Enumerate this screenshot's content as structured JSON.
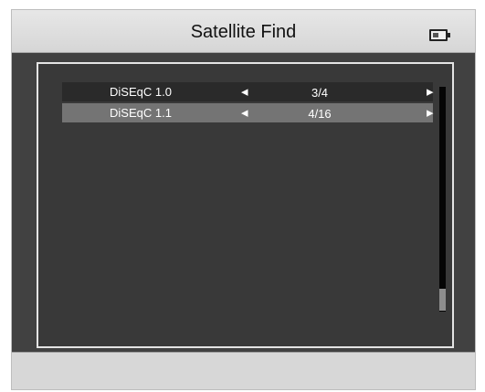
{
  "header": {
    "title": "Satellite Find",
    "battery_icon": "battery-icon"
  },
  "menu": {
    "items": [
      {
        "label": "DiSEqC 1.0",
        "value": "3/4",
        "selected": false
      },
      {
        "label": "DiSEqC 1.1",
        "value": "4/16",
        "selected": true
      }
    ],
    "left_arrow": "◂",
    "right_arrow": "▸"
  },
  "scroll": {
    "position_fraction": 0.9
  },
  "colors": {
    "screen_bg": "#d2d2d2",
    "content_bg": "#414141",
    "row_normal": "#2a2a2a",
    "row_selected": "#747474",
    "text": "#ffffff"
  }
}
